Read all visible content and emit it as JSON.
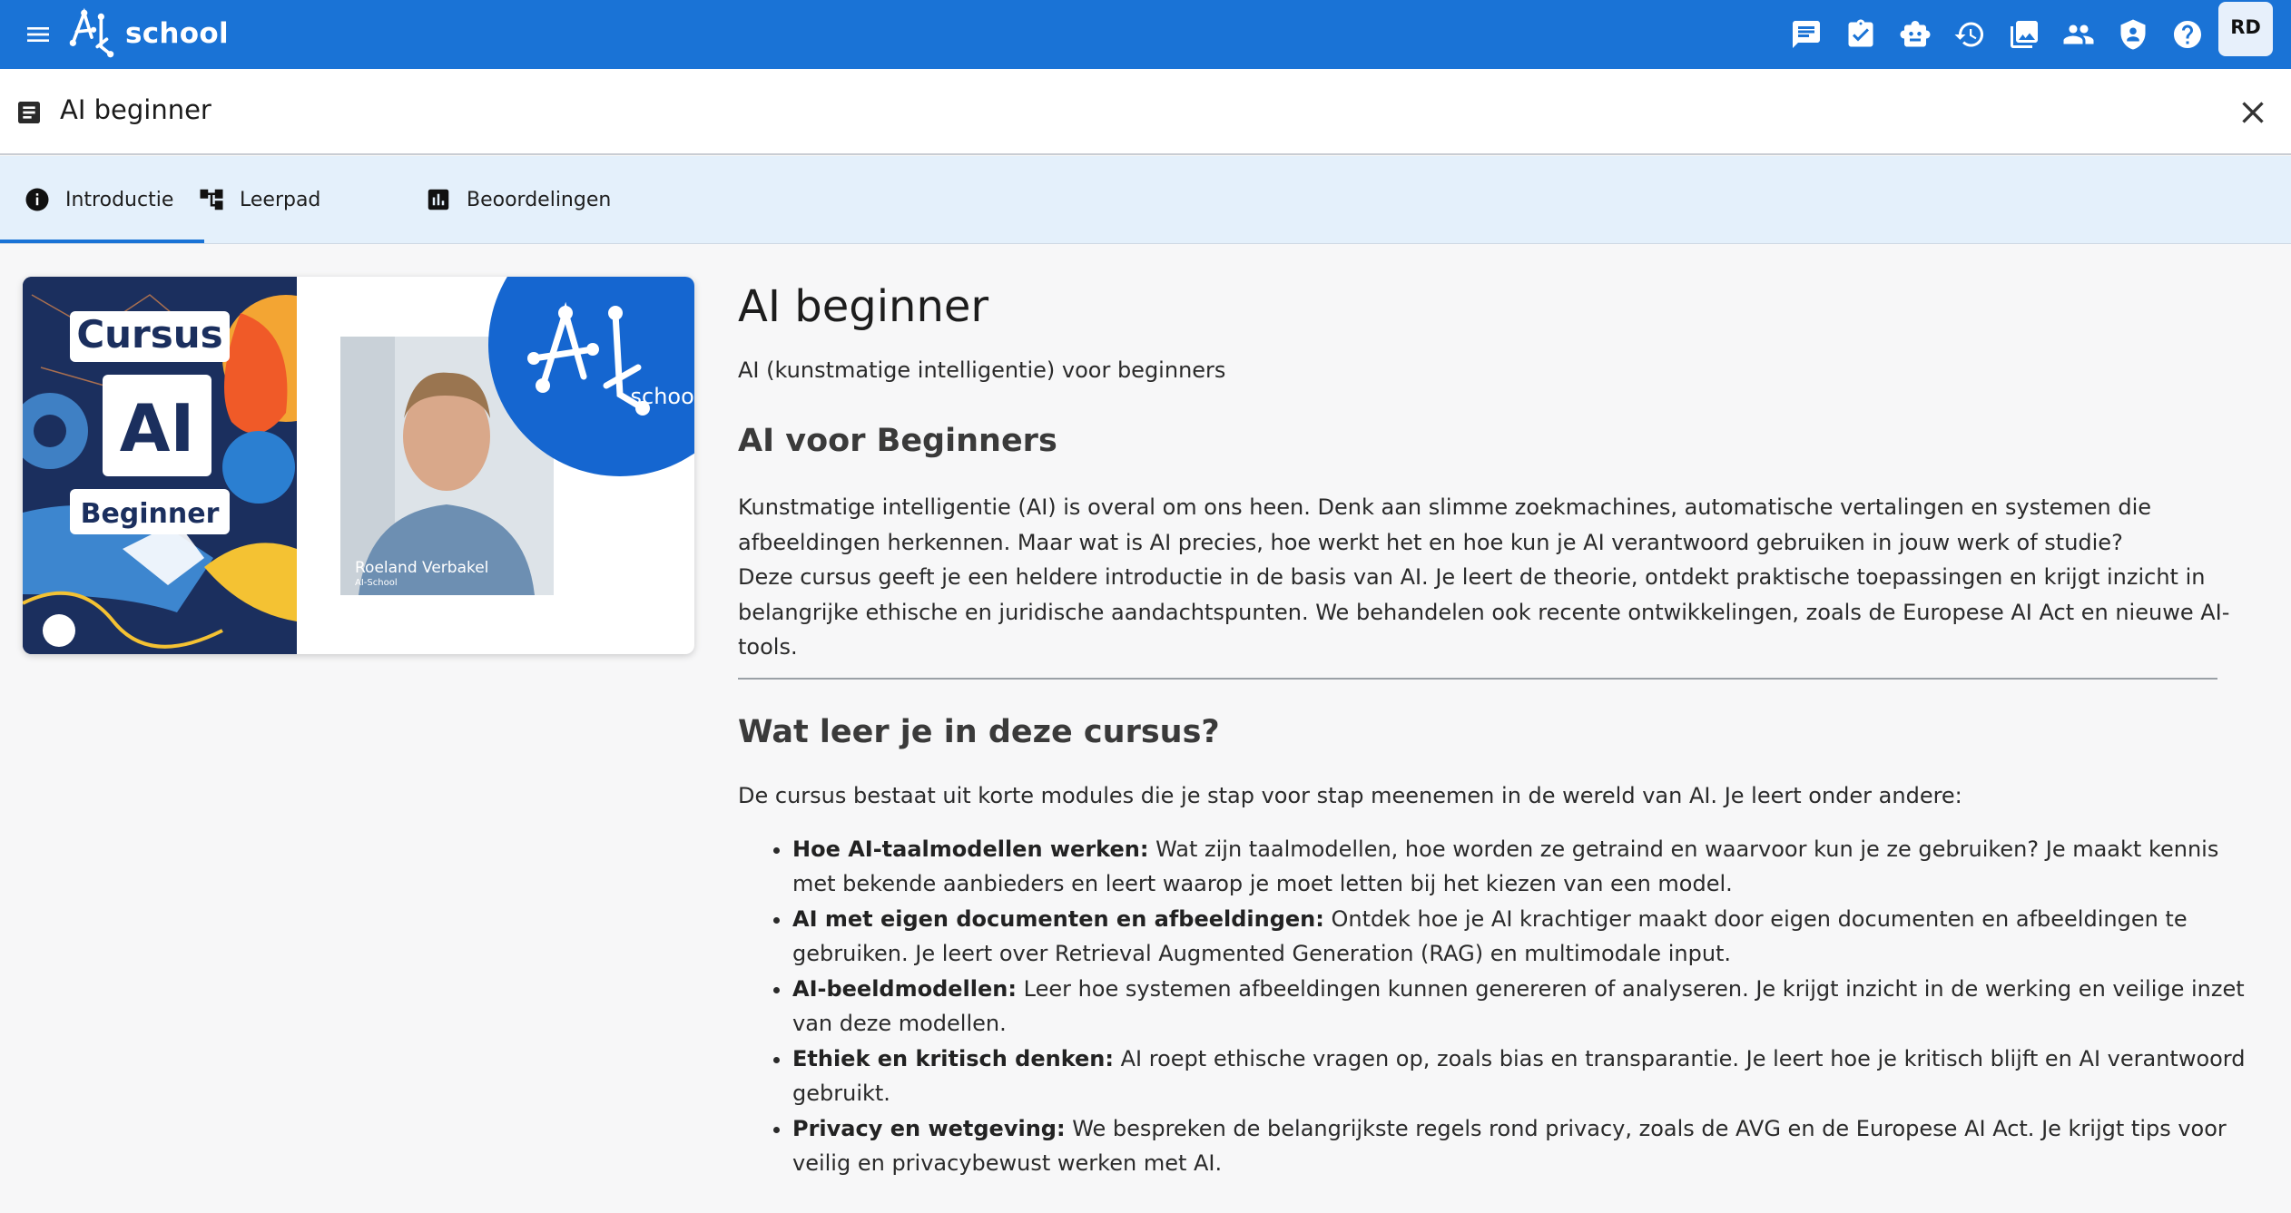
{
  "app": {
    "logo_text": "school",
    "user_initials": "RD"
  },
  "topbar_icons": [
    "chat-icon",
    "assignment-icon",
    "robot-icon",
    "history-icon",
    "gallery-icon",
    "people-icon",
    "security-icon",
    "help-icon"
  ],
  "page": {
    "title": "AI beginner"
  },
  "tabs": [
    {
      "label": "Introductie",
      "icon": "info-icon",
      "active": true
    },
    {
      "label": "Leerpad",
      "icon": "tree-icon",
      "active": false
    },
    {
      "label": "Beoordelingen",
      "icon": "chart-icon",
      "active": false
    }
  ],
  "course_image": {
    "badge_top": "Cursus",
    "badge_main": "AI",
    "badge_bottom": "Beginner",
    "person_name": "Roeland Verbakel",
    "person_org": "AI-School",
    "logo_word": "school"
  },
  "content": {
    "heading": "AI beginner",
    "subtitle": "AI (kunstmatige intelligentie) voor beginners",
    "section1_title": "AI voor Beginners",
    "section1_p1": "Kunstmatige intelligentie (AI) is overal om ons heen. Denk aan slimme zoekmachines, automatische vertalingen en systemen die afbeeldingen herkennen. Maar wat is AI precies, hoe werkt het en hoe kun je AI verantwoord gebruiken in jouw werk of studie?",
    "section1_p2": "Deze cursus geeft je een heldere introductie in de basis van AI. Je leert de theorie, ontdekt praktische toepassingen en krijgt inzicht in belangrijke ethische en juridische aandachtspunten. We behandelen ook recente ontwikkelingen, zoals de Europese AI Act en nieuwe AI-tools.",
    "section2_title": "Wat leer je in deze cursus?",
    "section2_intro": "De cursus bestaat uit korte modules die je stap voor stap meenemen in de wereld van AI. Je leert onder andere:",
    "topics": [
      {
        "title": "Hoe AI-taalmodellen werken:",
        "text": " Wat zijn taalmodellen, hoe worden ze getraind en waarvoor kun je ze gebruiken? Je maakt kennis met bekende aanbieders en leert waarop je moet letten bij het kiezen van een model."
      },
      {
        "title": "AI met eigen documenten en afbeeldingen:",
        "text": " Ontdek hoe je AI krachtiger maakt door eigen documenten en afbeeldingen te gebruiken. Je leert over Retrieval Augmented Generation (RAG) en multimodale input."
      },
      {
        "title": "AI-beeldmodellen:",
        "text": " Leer hoe systemen afbeeldingen kunnen genereren of analyseren. Je krijgt inzicht in de werking en veilige inzet van deze modellen."
      },
      {
        "title": "Ethiek en kritisch denken:",
        "text": " AI roept ethische vragen op, zoals bias en transparantie. Je leert hoe je kritisch blijft en AI verantwoord gebruikt."
      },
      {
        "title": "Privacy en wetgeving:",
        "text": " We bespreken de belangrijkste regels rond privacy, zoals de AVG en de Europese AI Act. Je krijgt tips voor veilig en privacybewust werken met AI."
      }
    ]
  },
  "colors": {
    "appbar": "#1a73d6",
    "tabs_bg": "#e4f0fb",
    "accent": "#1a73d6"
  }
}
